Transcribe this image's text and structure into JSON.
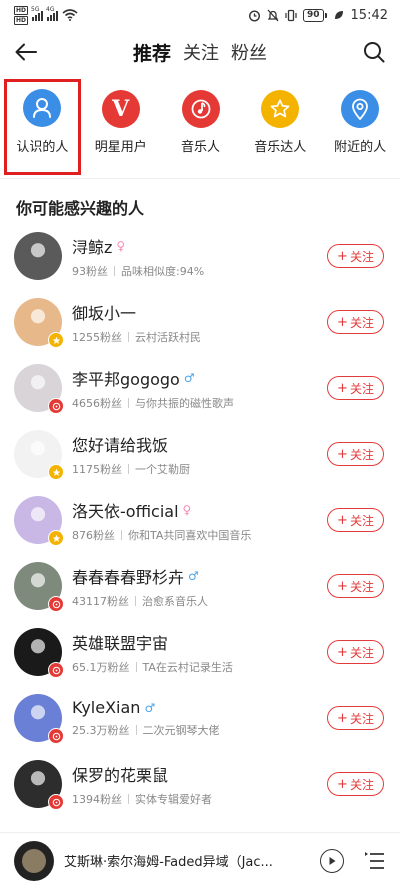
{
  "status_bar": {
    "sim1": "HD",
    "sim2": "HD",
    "net1": "5G",
    "net2": "4G",
    "battery": "90",
    "time": "15:42"
  },
  "header": {
    "tabs": [
      {
        "label": "推荐",
        "active": true
      },
      {
        "label": "关注",
        "active": false
      },
      {
        "label": "粉丝",
        "active": false
      }
    ]
  },
  "categories": [
    {
      "label": "认识的人",
      "icon": "person-icon",
      "color": "#3a8ee6"
    },
    {
      "label": "明星用户",
      "icon": "v-icon",
      "color": "#e53935"
    },
    {
      "label": "音乐人",
      "icon": "music-note-icon",
      "color": "#e53935"
    },
    {
      "label": "音乐达人",
      "icon": "star-icon",
      "color": "#f5b301"
    },
    {
      "label": "附近的人",
      "icon": "location-pin-icon",
      "color": "#3a8ee6"
    }
  ],
  "section_title": "你可能感兴趣的人",
  "users": [
    {
      "name": "浔鲸z",
      "gender": "f",
      "fans": "93粉丝",
      "desc": "品味相似度:94%",
      "badge": "",
      "avatar_color": "#5a5a5a"
    },
    {
      "name": "御坂小一",
      "gender": "",
      "fans": "1255粉丝",
      "desc": "云村活跃村民",
      "badge": "star",
      "avatar_color": "#e7b98a"
    },
    {
      "name": "李平邦gogogo",
      "gender": "m",
      "fans": "4656粉丝",
      "desc": "与你共振的磁性歌声",
      "badge": "music",
      "avatar_color": "#d9d4d8"
    },
    {
      "name": "您好请给我饭",
      "gender": "",
      "fans": "1175粉丝",
      "desc": "一个艾勒厨",
      "badge": "star",
      "avatar_color": "#f2f2f2"
    },
    {
      "name": "洛天依-official",
      "gender": "f",
      "fans": "876粉丝",
      "desc": "你和TA共同喜欢中国音乐",
      "badge": "star",
      "avatar_color": "#c9b8e6"
    },
    {
      "name": "春春春春野杉卉",
      "gender": "m",
      "fans": "43117粉丝",
      "desc": "治愈系音乐人",
      "badge": "music",
      "avatar_color": "#7d8a7c"
    },
    {
      "name": "英雄联盟宇宙",
      "gender": "",
      "fans": "65.1万粉丝",
      "desc": "TA在云村记录生活",
      "badge": "music",
      "avatar_color": "#1a1a1a"
    },
    {
      "name": "KyleXian",
      "gender": "m",
      "fans": "25.3万粉丝",
      "desc": "二次元钢琴大佬",
      "badge": "music",
      "avatar_color": "#6a7fd6"
    },
    {
      "name": "保罗的花栗鼠",
      "gender": "",
      "fans": "1394粉丝",
      "desc": "实体专辑爱好者",
      "badge": "music",
      "avatar_color": "#2d2d2d"
    }
  ],
  "follow_label": "关注",
  "player": {
    "song": "艾斯琳·索尔海姆-Faded异域（Jac..."
  }
}
